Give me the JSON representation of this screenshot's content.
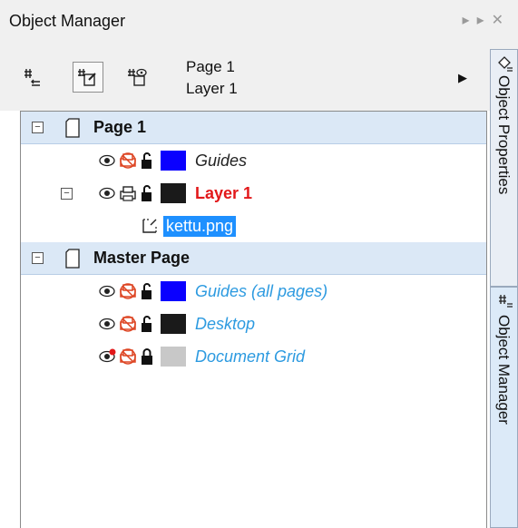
{
  "window": {
    "title": "Object Manager"
  },
  "toolbar": {
    "page_label": "Page 1",
    "layer_label": "Layer 1"
  },
  "tree": {
    "page1": {
      "label": "Page 1",
      "guides": {
        "label": "Guides",
        "color": "#0a00ff"
      },
      "layer1": {
        "label": "Layer 1",
        "color": "#1a1a1a",
        "object": {
          "label": "kettu.png"
        }
      }
    },
    "master": {
      "label": "Master Page",
      "guides_all": {
        "label": "Guides (all pages)",
        "color": "#0a00ff"
      },
      "desktop": {
        "label": "Desktop",
        "color": "#1a1a1a"
      },
      "grid": {
        "label": "Document Grid",
        "color": "#c8c8c8"
      }
    }
  },
  "sidetabs": {
    "properties": "Object Properties",
    "manager": "Object Manager"
  },
  "colors": {
    "selection": "#1e90ff",
    "active_layer": "#e2181a",
    "master_items": "#2c9ae0"
  }
}
